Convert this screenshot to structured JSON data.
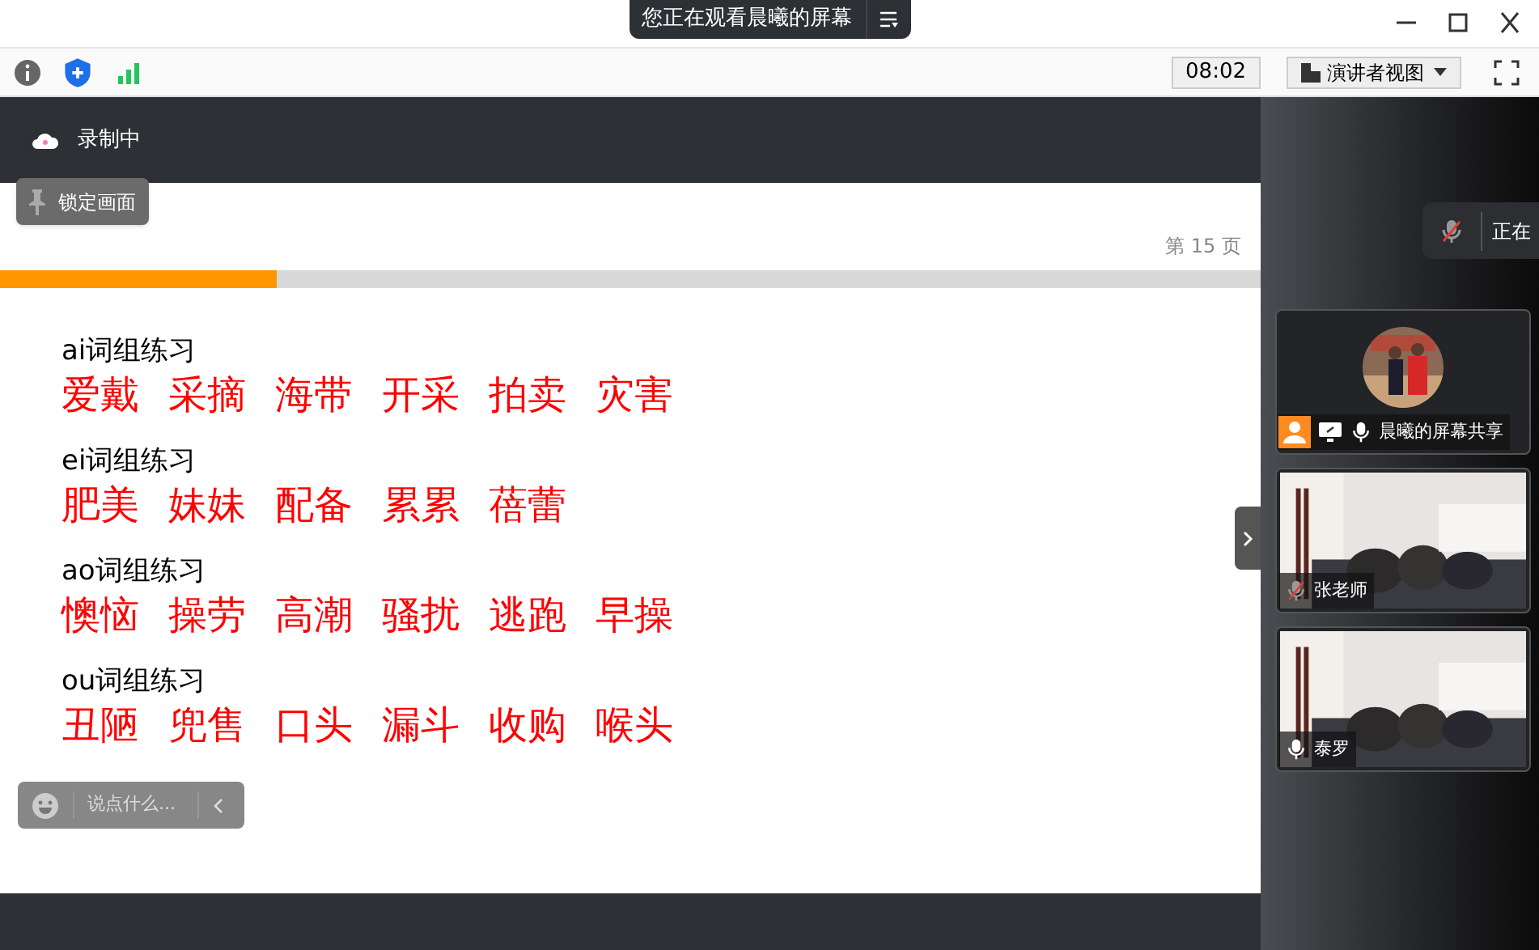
{
  "window": {
    "title": "您正在观看晨曦的屏幕"
  },
  "toolbar": {
    "time": "08:02",
    "view_mode": "演讲者视图"
  },
  "recording": {
    "label": "录制中"
  },
  "lock_button": {
    "label": "锁定画面"
  },
  "slide": {
    "page": "第 15 页",
    "progress": {
      "level": 0.22
    },
    "sections": [
      {
        "heading": "ai词组练习",
        "words": [
          "爱戴",
          "采摘",
          "海带",
          "开采",
          "拍卖",
          "灾害"
        ]
      },
      {
        "heading": "ei词组练习",
        "words": [
          "肥美",
          "妹妹",
          "配备",
          "累累",
          "蓓蕾"
        ]
      },
      {
        "heading": "ao词组练习",
        "words": [
          "懊恼",
          "操劳",
          "高潮",
          "骚扰",
          "逃跑",
          "早操"
        ]
      },
      {
        "heading": "ou词组练习",
        "words": [
          "丑陋",
          "兜售",
          "口头",
          "漏斗",
          "收购",
          "喉头"
        ]
      }
    ]
  },
  "chat": {
    "placeholder": "说点什么..."
  },
  "speaking_notice": {
    "label": "正在",
    "muted": true
  },
  "participants": [
    {
      "name": "晨曦的屏幕共享",
      "muted": false,
      "kind": "avatar",
      "sharing": true
    },
    {
      "name": "张老师",
      "muted": true,
      "kind": "video",
      "sharing": false
    },
    {
      "name": "泰罗",
      "muted": false,
      "kind": "video",
      "sharing": false
    }
  ]
}
